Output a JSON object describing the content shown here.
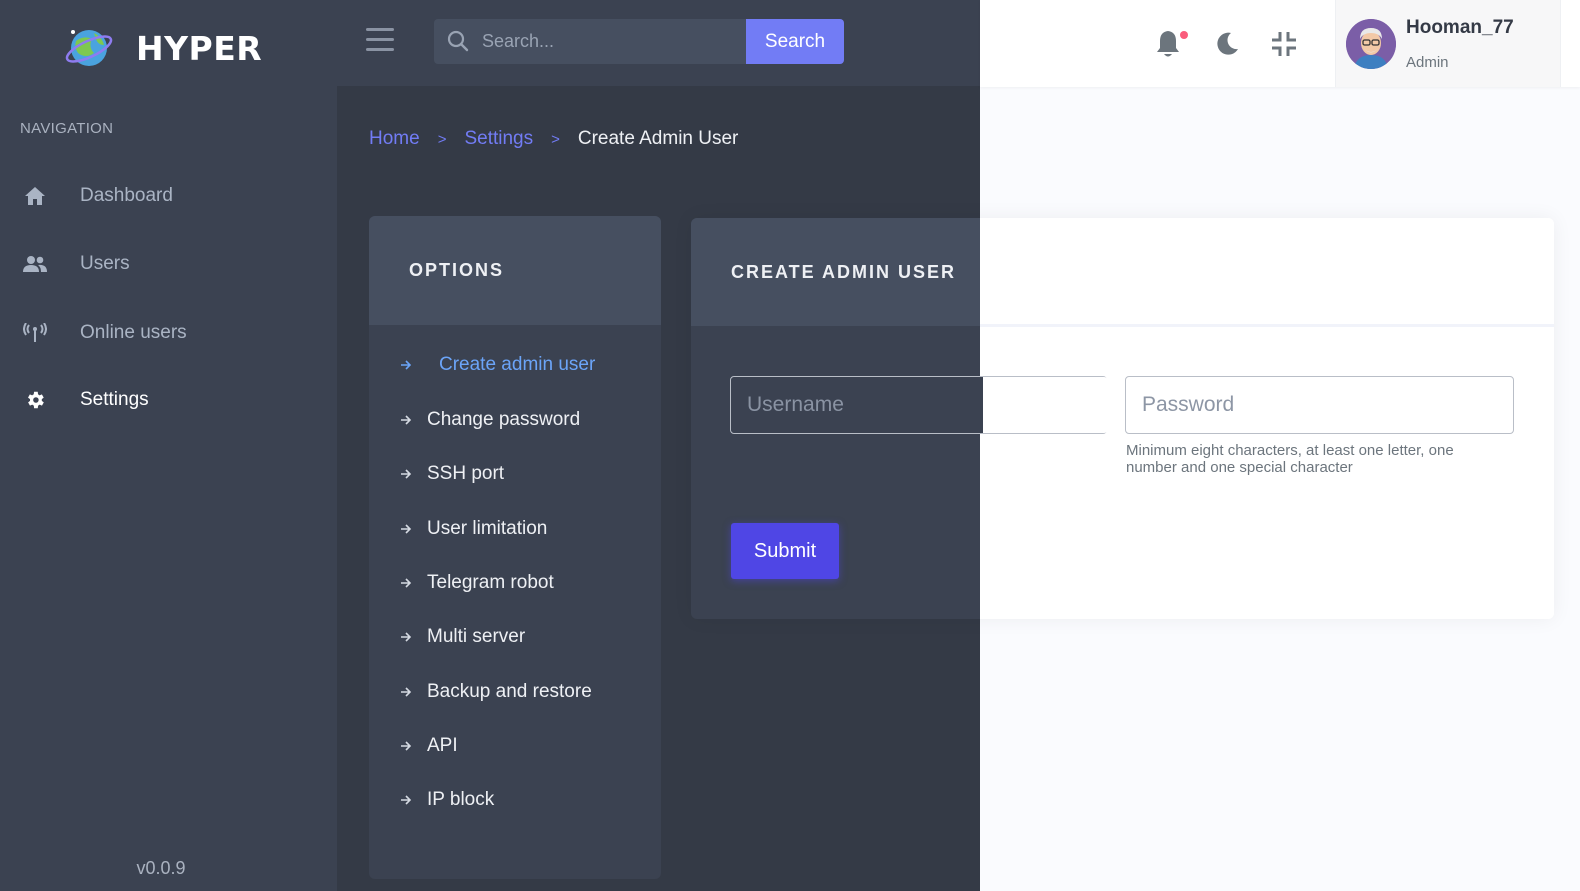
{
  "brand": {
    "name": "HYPER"
  },
  "sidebar": {
    "title": "NAVIGATION",
    "items": [
      {
        "label": "Dashboard",
        "icon": "home-icon"
      },
      {
        "label": "Users",
        "icon": "users-icon"
      },
      {
        "label": "Online users",
        "icon": "antenna-icon"
      },
      {
        "label": "Settings",
        "icon": "gear-icon",
        "active": true
      }
    ],
    "version": "v0.0.9"
  },
  "topbar": {
    "search_placeholder": "Search...",
    "search_button": "Search",
    "user": {
      "name": "Hooman_77",
      "role": "Admin"
    }
  },
  "breadcrumb": {
    "home": "Home",
    "separator": ">",
    "settings": "Settings",
    "current": "Create Admin User"
  },
  "options": {
    "title": "OPTIONS",
    "items": [
      {
        "label": "Create admin user",
        "active": true
      },
      {
        "label": "Change password"
      },
      {
        "label": "SSH port"
      },
      {
        "label": "User limitation"
      },
      {
        "label": "Telegram robot"
      },
      {
        "label": "Multi server"
      },
      {
        "label": "Backup and restore"
      },
      {
        "label": "API"
      },
      {
        "label": "IP block"
      }
    ]
  },
  "form": {
    "title": "CREATE ADMIN USER",
    "username_placeholder": "Username",
    "password_placeholder": "Password",
    "password_hint": "Minimum eight characters, at least one letter, one number and one special character",
    "submit_label": "Submit"
  },
  "colors": {
    "accent": "#727cf5",
    "submit": "#4f46e5",
    "active_link": "#6ba4f8",
    "sidebar_bg": "#3b4251",
    "notification": "#fa5c7c"
  }
}
